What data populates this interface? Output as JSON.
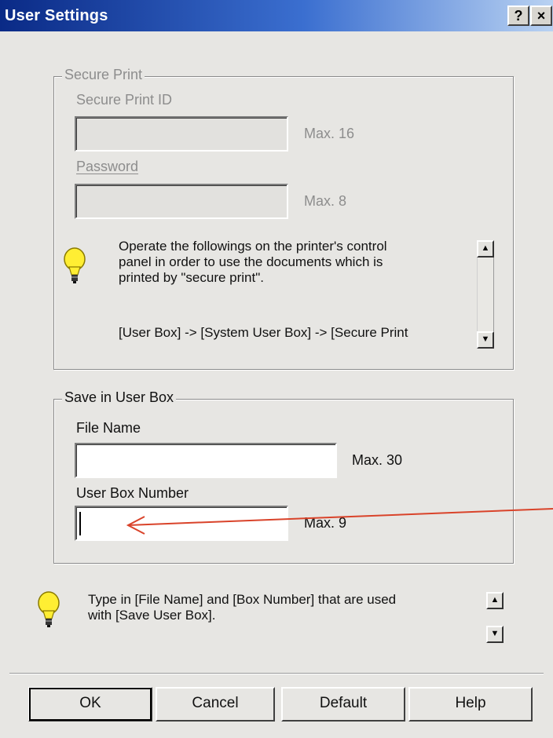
{
  "window": {
    "title": "User Settings",
    "help_button": "?",
    "close_button": "×"
  },
  "secure_print": {
    "legend": "Secure Print",
    "id_label": "Secure Print ID",
    "id_max": "Max. 16",
    "password_label": "Password",
    "password_max": "Max. 8",
    "info_line1": "Operate the followings on the printer's control",
    "info_line2": "panel in order to use the documents which is",
    "info_line3": "printed by \"secure print\".",
    "info_line4": "[User Box] -> [System User Box] -> [Secure Print"
  },
  "save_in_user_box": {
    "legend": "Save in User Box",
    "file_name_label": "File Name",
    "file_name_value": "",
    "file_name_max": "Max. 30",
    "box_number_label": "User Box Number",
    "box_number_value": "",
    "box_number_max": "Max. 9"
  },
  "hint": {
    "line1": "Type in [File Name] and [Box Number] that are used",
    "line2": "with [Save User Box]."
  },
  "buttons": {
    "ok": "OK",
    "cancel": "Cancel",
    "default": "Default",
    "help": "Help"
  },
  "colors": {
    "title_gradient_start": "#0a2a86",
    "title_gradient_end": "#b9d2f2",
    "annotation_arrow": "#d9432a",
    "bulb": "#ffee33"
  },
  "icons": {
    "hint": "lightbulb-icon",
    "scroll_up": "triangle-up-icon",
    "scroll_down": "triangle-down-icon"
  }
}
